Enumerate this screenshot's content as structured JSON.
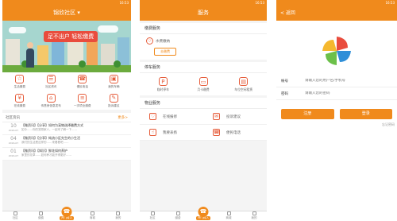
{
  "home": {
    "status": {
      "left": "",
      "right": "16:53"
    },
    "title": "锦欣社区",
    "banner_slogan": "足不出户 轻松缴费",
    "grid": [
      {
        "label": "生活缴费",
        "icon": "wallet-icon",
        "glyph": "☆"
      },
      {
        "label": "社区资讯",
        "icon": "news-icon",
        "glyph": "☰"
      },
      {
        "label": "便民电话",
        "icon": "phone-icon",
        "glyph": "☎"
      },
      {
        "label": "我的车辆",
        "icon": "car-icon",
        "glyph": "▣"
      },
      {
        "label": "在线缴费",
        "icon": "pay-icon",
        "glyph": "¥"
      },
      {
        "label": "传售房信息发布",
        "icon": "house-icon",
        "glyph": "⌂"
      },
      {
        "label": "一次项业缴费",
        "icon": "bill-icon",
        "glyph": "≡"
      },
      {
        "label": "投诉建议",
        "icon": "complaint-icon",
        "glyph": "✎"
      }
    ],
    "news_header": "社区资讯",
    "news_more": "更多>",
    "news": [
      {
        "day": "10",
        "ym": "2016-07",
        "title": "【微资讯】【分享】如何为宠物选择缴费方式",
        "sub": "如今……你的宠物家人，一起来了解一下……"
      },
      {
        "day": "04",
        "ym": "2016-07",
        "title": "【微资讯】【分享】纯流小区先生的小生活",
        "sub": "我们的生活是这样的……来看看吧……"
      },
      {
        "day": "01",
        "ym": "2016-07",
        "title": "【微资讯】【知识】鲜花如何养护",
        "sub": "家里的花草……如何养才能开得更好……"
      }
    ],
    "tabs": [
      "社区",
      "缴费",
      "开门转入",
      "商城",
      "我的"
    ]
  },
  "service": {
    "status": {
      "left": "",
      "right": "16:53"
    },
    "title": "服务",
    "life_header": "缴费服务",
    "life_item": "水费缴纳",
    "life_button": "去缴费",
    "park_header": "停车服务",
    "park_items": [
      {
        "label": "临时停车",
        "icon": "parking-icon",
        "glyph": "P"
      },
      {
        "label": "月卡缴费",
        "icon": "card-icon",
        "glyph": "▭"
      },
      {
        "label": "车位空闲租赁",
        "icon": "lease-icon",
        "glyph": "▤"
      }
    ],
    "prop_header": "物业服务",
    "prop_items": [
      {
        "label": "在线报修",
        "icon": "repair-icon",
        "glyph": "♡"
      },
      {
        "label": "投诉建议",
        "icon": "suggest-icon",
        "glyph": "✉"
      },
      {
        "label": "我要表扬",
        "icon": "thumbs-up-icon",
        "glyph": "☝"
      },
      {
        "label": "便民电话",
        "icon": "phone-icon",
        "glyph": "☎"
      }
    ],
    "tabs": [
      "社区",
      "缴费",
      "开门转入",
      "商城",
      "我的"
    ]
  },
  "login": {
    "status": {
      "left": "",
      "right": "16:53"
    },
    "back": "< 返回",
    "account_label": "帐号",
    "account_placeholder": "请输入您的用户名/手机号",
    "password_label": "密码",
    "password_placeholder": "请输入您的密码",
    "register_label": "注册",
    "login_label": "登录",
    "forgot_label": "忘记密码"
  },
  "colors": {
    "accent": "#f08a1c",
    "icon": "#e65c3a",
    "banner": "#a6d6cf"
  }
}
